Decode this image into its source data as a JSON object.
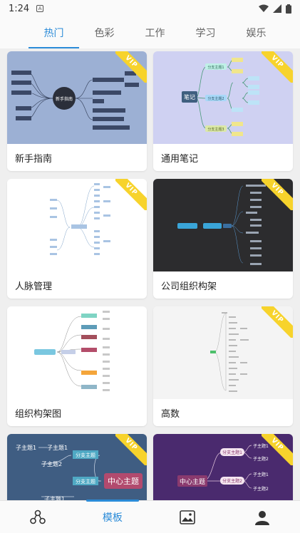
{
  "status": {
    "time": "1:24",
    "notif": "A"
  },
  "tabs": [
    "热门",
    "色彩",
    "工作",
    "学习",
    "娱乐"
  ],
  "active_tab": 0,
  "cards": [
    {
      "title": "新手指南",
      "vip": true,
      "vip_label": "VIP",
      "center_node": "新手指南"
    },
    {
      "title": "通用笔记",
      "vip": true,
      "vip_label": "VIP",
      "center_node": "笔记",
      "branches": [
        "分支主题1",
        "分支主题2",
        "分支主题3"
      ],
      "sub": "子主题1"
    },
    {
      "title": "人脉管理",
      "vip": true,
      "vip_label": "VIP"
    },
    {
      "title": "公司组织构架",
      "vip": true,
      "vip_label": "VIP"
    },
    {
      "title": "组织构架图",
      "vip": false
    },
    {
      "title": "高数",
      "vip": true,
      "vip_label": "VIP"
    },
    {
      "title": "",
      "vip": true,
      "vip_label": "VIP",
      "center_node": "中心主题",
      "branch": "分支主题",
      "subs": [
        "子主题1",
        "子主题1",
        "子主题2"
      ]
    },
    {
      "title": "",
      "vip": true,
      "vip_label": "VIP",
      "center_node": "中心主题",
      "branches": [
        "分支主题1",
        "分支主题2"
      ],
      "subs": [
        "子主题1",
        "子主题2",
        "子主题1",
        "子主题2"
      ]
    }
  ],
  "bottom_nav": {
    "active_label": "模板"
  },
  "colors": {
    "accent": "#2a8bd8",
    "vip": "#f7d32c"
  }
}
